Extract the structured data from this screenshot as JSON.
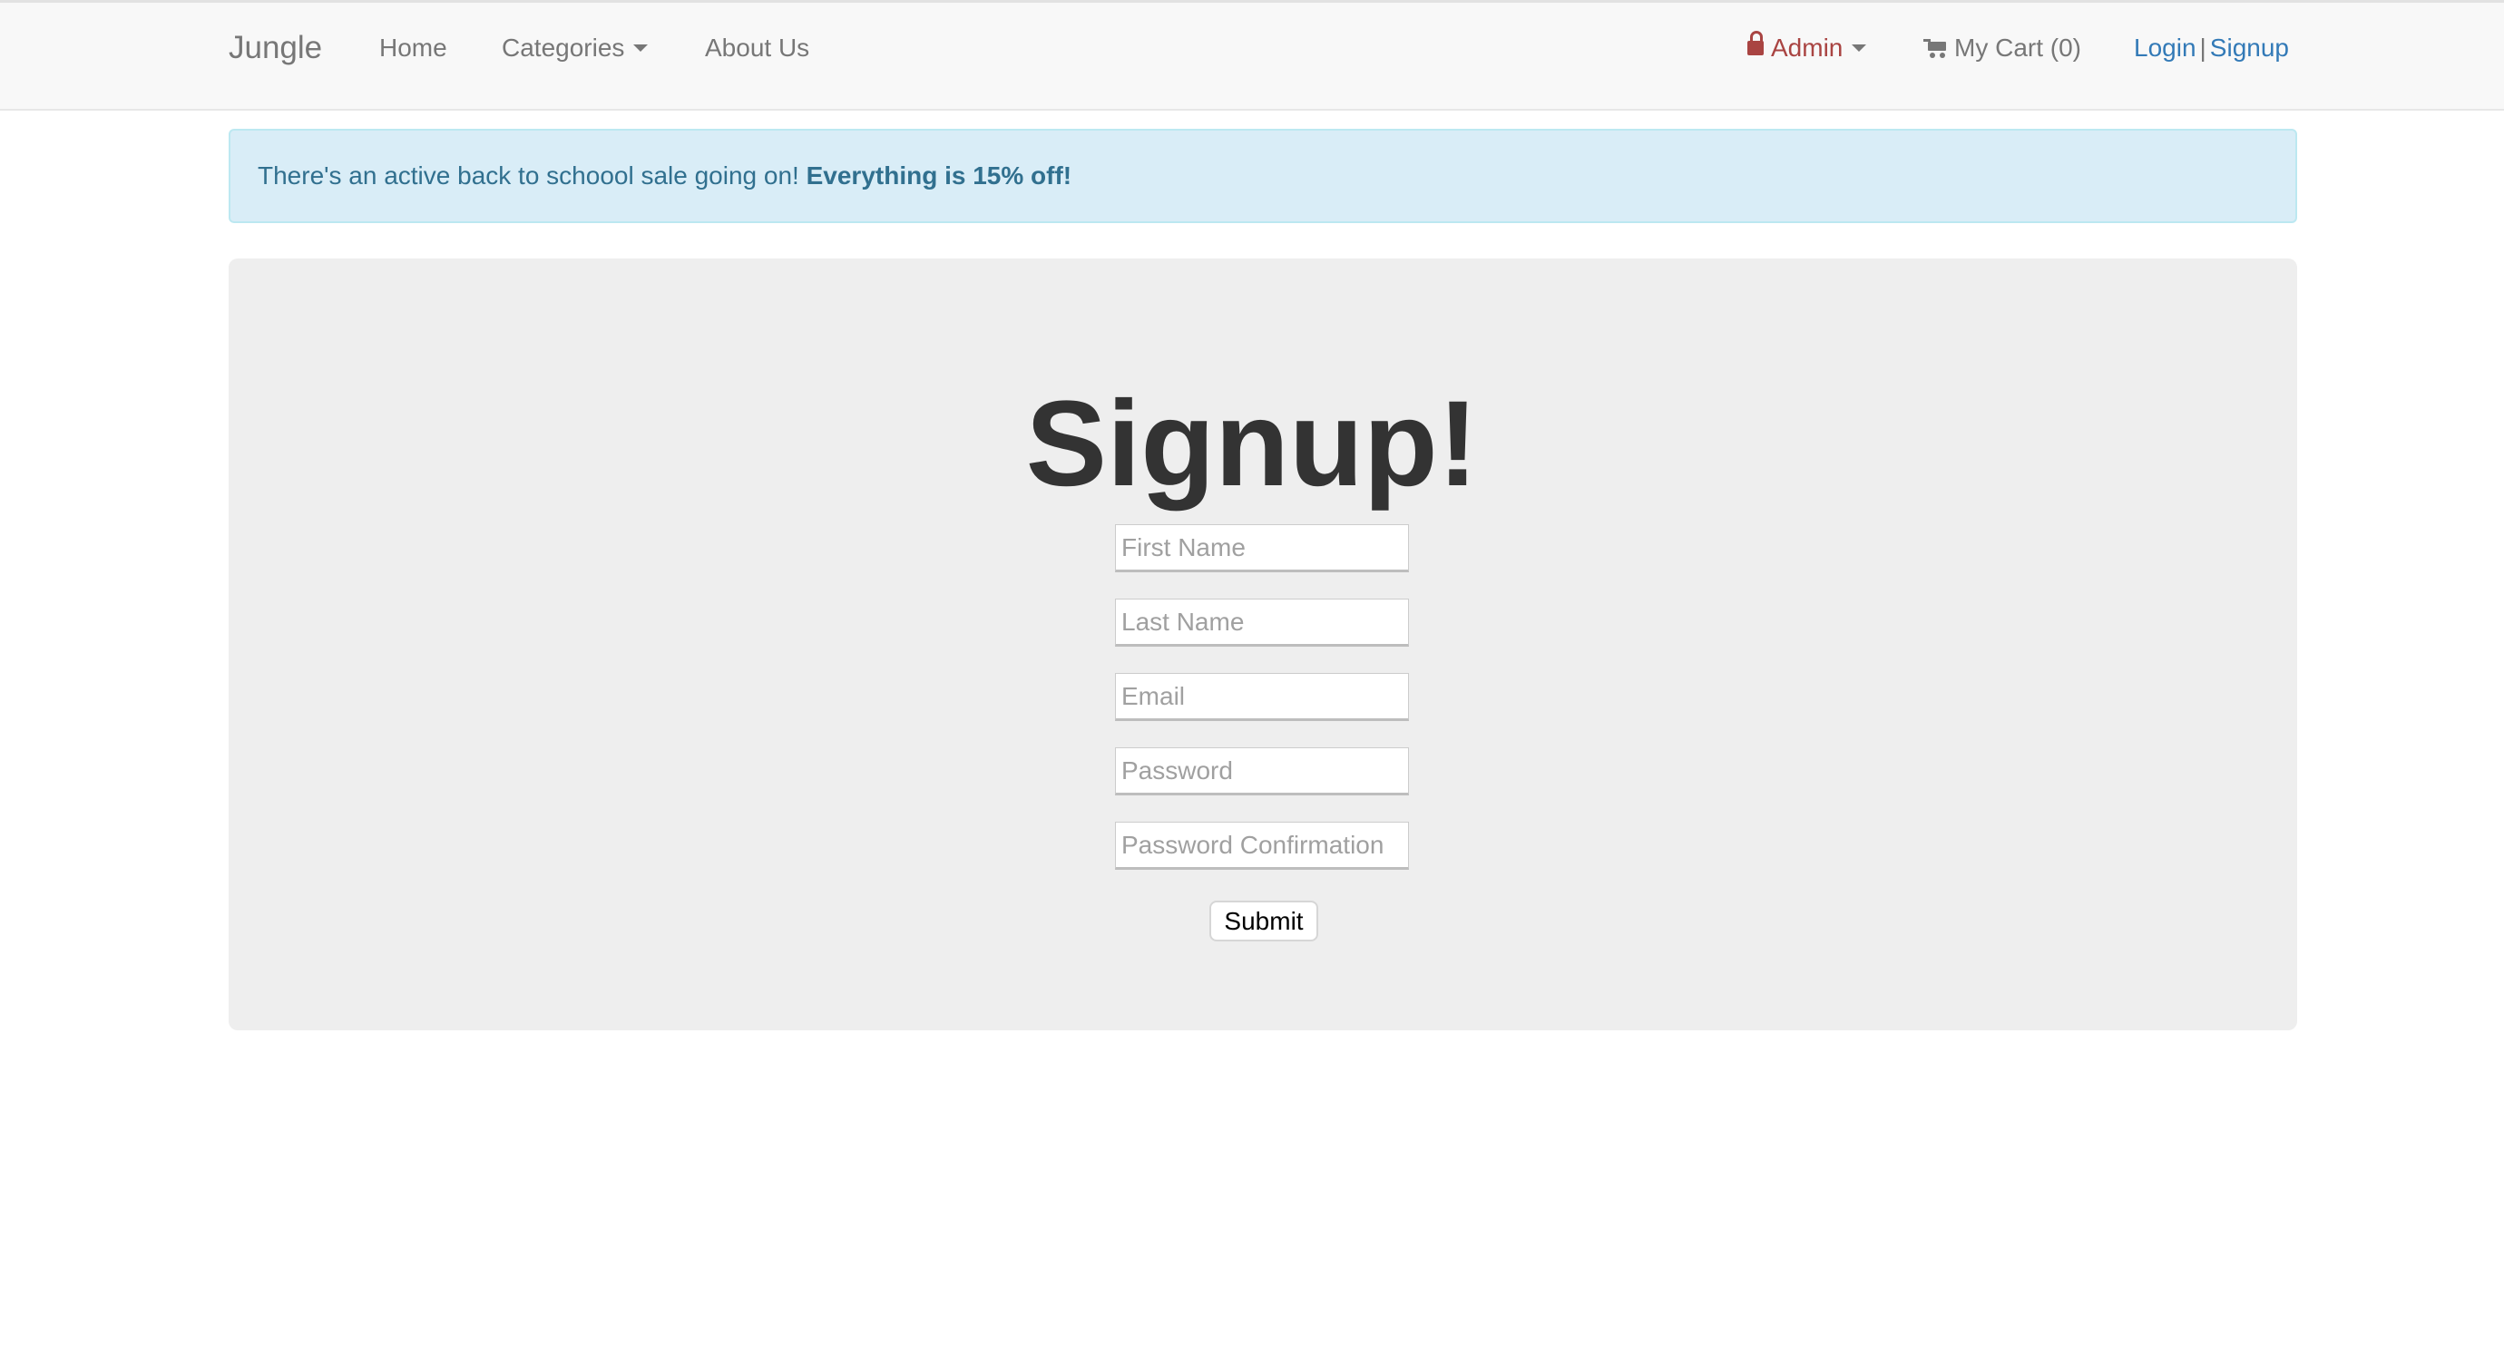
{
  "navbar": {
    "brand": "Jungle",
    "home": "Home",
    "categories": "Categories",
    "about": "About Us",
    "admin": "Admin",
    "cart": "My Cart (0)",
    "login": "Login",
    "separator": "|",
    "signup": "Signup",
    "icons": {
      "admin": "lock-icon",
      "cart": "shopping-cart-icon",
      "dropdown": "caret-down-icon"
    },
    "colors": {
      "admin": "#a94442",
      "link": "#337ab7",
      "muted": "#777777"
    }
  },
  "alert": {
    "text": "There's an active back to schoool sale going on!",
    "emphasis": "Everything is 15% off!",
    "colors": {
      "background": "#d9edf7",
      "text": "#31708f"
    }
  },
  "form": {
    "title": "Signup!",
    "fields": [
      {
        "placeholder": "First Name",
        "value": ""
      },
      {
        "placeholder": "Last Name",
        "value": ""
      },
      {
        "placeholder": "Email",
        "value": ""
      },
      {
        "placeholder": "Password",
        "value": ""
      },
      {
        "placeholder": "Password Confirmation",
        "value": ""
      }
    ],
    "submit_label": "Submit"
  }
}
